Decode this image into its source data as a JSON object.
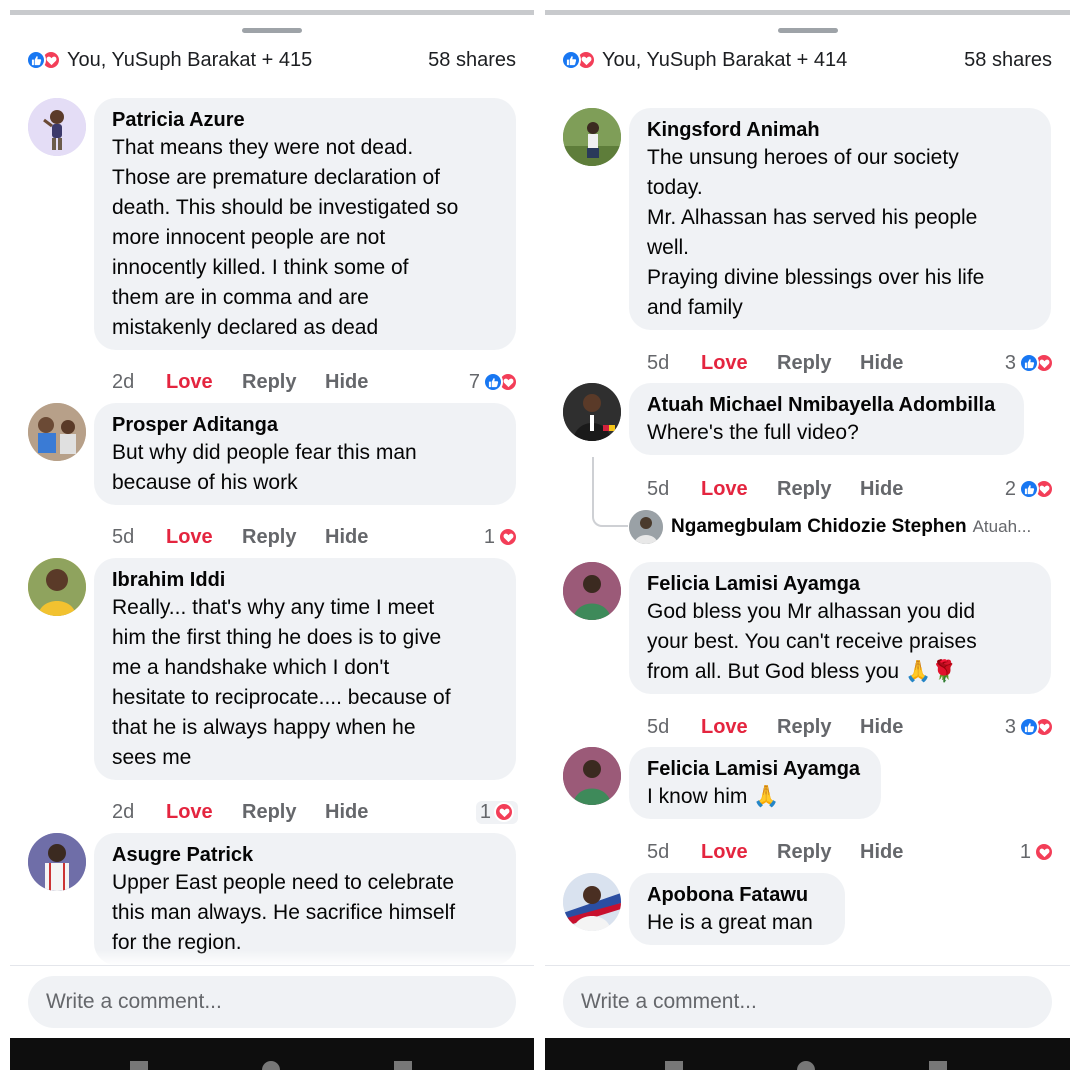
{
  "left_panel": {
    "header": {
      "names": "You, YuSuph Barakat + 415",
      "shares": "58 shares"
    },
    "comments": [
      {
        "author": "Patricia Azure",
        "text": "That means they were not dead.\nThose are premature declaration of\ndeath. This should be investigated so\nmore innocent people are not\ninnocently killed. I think some of\nthem are in comma and are\nmistakenly declared as dead",
        "time": "2d",
        "love": "Love",
        "reply": "Reply",
        "hide": "Hide",
        "count": "7"
      },
      {
        "author": "Prosper Aditanga",
        "text": "But why did people fear this man\nbecause of his work",
        "time": "5d",
        "love": "Love",
        "reply": "Reply",
        "hide": "Hide",
        "count": "1"
      },
      {
        "author": "Ibrahim Iddi",
        "text": "Really... that's why any time I meet\nhim the first thing he does is to give\nme a handshake which I don't\nhesitate to reciprocate.... because of\nthat he is always happy when he\nsees me",
        "time": "2d",
        "love": "Love",
        "reply": "Reply",
        "hide": "Hide",
        "count": "1"
      },
      {
        "author": "Asugre Patrick",
        "text": "Upper East people need to celebrate\nthis man always. He sacrifice himself\nfor the region."
      }
    ],
    "composer_placeholder": "Write a comment..."
  },
  "right_panel": {
    "header": {
      "names": "You, YuSuph Barakat + 414",
      "shares": "58 shares"
    },
    "comments": [
      {
        "author": "Kingsford Animah",
        "text": "The unsung heroes of our society\ntoday.\nMr. Alhassan has served his people\nwell.\nPraying divine blessings over his life\nand family",
        "time": "5d",
        "love": "Love",
        "reply": "Reply",
        "hide": "Hide",
        "count": "3"
      },
      {
        "author": "Atuah Michael Nmibayella Adombilla",
        "text": "Where's the full video?",
        "time": "5d",
        "love": "Love",
        "reply": "Reply",
        "hide": "Hide",
        "count": "2"
      },
      {
        "author": "Felicia Lamisi Ayamga",
        "text": "God bless you Mr alhassan you did\nyour best. You can't receive praises\nfrom all. But God bless you 🙏🌹",
        "time": "5d",
        "love": "Love",
        "reply": "Reply",
        "hide": "Hide",
        "count": "3"
      },
      {
        "author": "Felicia Lamisi Ayamga",
        "text": "I know him 🙏",
        "time": "5d",
        "love": "Love",
        "reply": "Reply",
        "hide": "Hide",
        "count": "1"
      },
      {
        "author": "Apobona Fatawu",
        "text": "He is a great man"
      }
    ],
    "reply_preview": {
      "name": "Ngamegbulam Chidozie Stephen",
      "snippet": "Atuah..."
    },
    "composer_placeholder": "Write a comment..."
  },
  "colors": {
    "like": "#1877f2",
    "love": "#f33e58",
    "love_action": "#e4253f",
    "bubble": "#f0f2f5",
    "meta": "#65676b"
  },
  "icons": {
    "like": "thumbs-up-icon",
    "love": "heart-icon"
  }
}
